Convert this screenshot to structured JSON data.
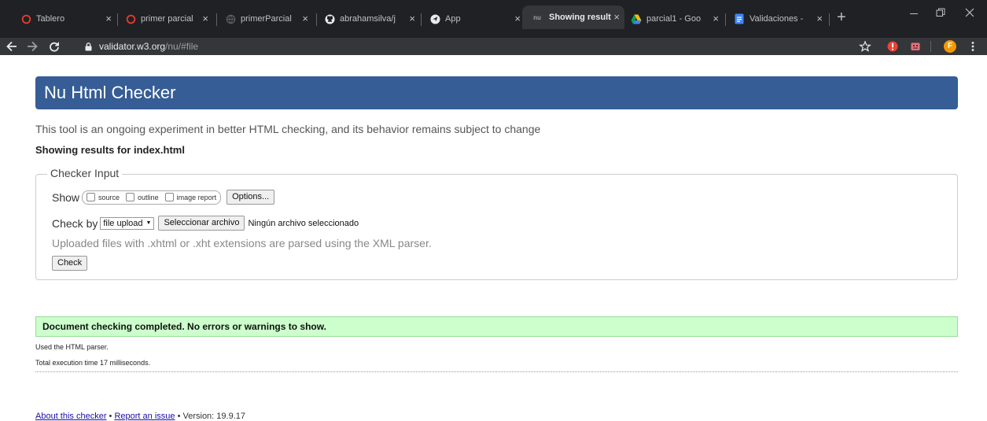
{
  "browser": {
    "tabs": [
      {
        "title": "Tablero",
        "icon": "canvas-icon"
      },
      {
        "title": "primer parcial",
        "icon": "canvas-icon"
      },
      {
        "title": "primerParcial",
        "icon": "globe-icon"
      },
      {
        "title": "abrahamsilva/j",
        "icon": "github-icon"
      },
      {
        "title": "App",
        "icon": "globe-icon"
      },
      {
        "title": "Showing result",
        "icon": "nu-icon",
        "favicon_text": "nu"
      },
      {
        "title": "parcial1 - Goo",
        "icon": "drive-icon"
      },
      {
        "title": "Validaciones -",
        "icon": "docs-icon"
      }
    ],
    "active_tab": 5,
    "url_host": "validator.w3.org",
    "url_path": "/nu/#file",
    "profile_initial": "F",
    "close_glyph": "×",
    "newtab_glyph": "+"
  },
  "page": {
    "banner_title": "Nu Html Checker",
    "intro": "This tool is an ongoing experiment in better HTML checking, and its behavior remains subject to change",
    "showing": "Showing results for index.html",
    "legend": "Checker Input",
    "show_label": "Show",
    "checkbox_source": "source",
    "checkbox_outline": "outline",
    "checkbox_image_report": "image report",
    "options_button": "Options...",
    "check_by_label": "Check by",
    "check_by_value": "file upload",
    "file_button": "Seleccionar archivo",
    "no_file": "Ningún archivo seleccionado",
    "hint": "Uploaded files with .xhtml or .xht extensions are parsed using the XML parser.",
    "check_button": "Check",
    "success": "Document checking completed. No errors or warnings to show.",
    "parser_note": "Used the HTML parser.",
    "exec_time": "Total execution time 17 milliseconds.",
    "footer_about": "About this checker",
    "footer_sep1": " • ",
    "footer_report": "Report an issue",
    "footer_sep2": " • ",
    "footer_version": "Version: 19.9.17"
  },
  "colors": {
    "banner": "#365d95",
    "success_bg": "#ccffcc",
    "chrome_dark": "#202124",
    "chrome_toolbar": "#35363a"
  }
}
